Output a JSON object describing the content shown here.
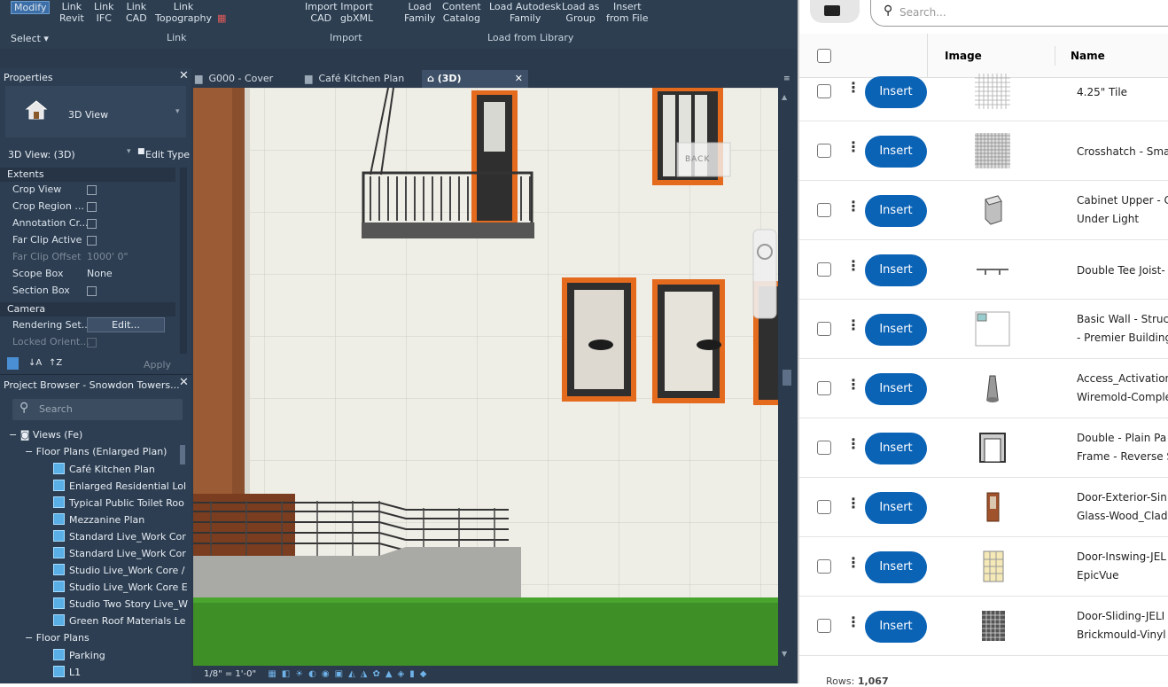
{
  "ribbon": {
    "modify": "Modify",
    "select": "Select ▾",
    "link_revit": "Link\nRevit",
    "link_ifc": "Link\nIFC",
    "link_cad": "Link\nCAD",
    "link_topo": "Link\nTopography",
    "link_group": "Link",
    "import_cad": "Import\nCAD",
    "import_gbxml": "Import\ngbXML",
    "import_group": "Import",
    "load_family": "Load\nFamily",
    "content_catalog": "Content\nCatalog",
    "load_autodesk": "Load Autodesk\nFamily",
    "load_group": "Load as\nGroup",
    "insert_file": "Insert\nfrom File",
    "load_library_group": "Load from Library"
  },
  "properties": {
    "title": "Properties",
    "type_name": "3D View",
    "view_selector": "3D View: (3D)",
    "edit_type": "Edit Type",
    "extents": "Extents",
    "rows": [
      {
        "label": "Crop View",
        "kind": "check"
      },
      {
        "label": "Crop Region ...",
        "kind": "check"
      },
      {
        "label": "Annotation Cr...",
        "kind": "check"
      },
      {
        "label": "Far Clip Active",
        "kind": "check"
      },
      {
        "label": "Far Clip Offset",
        "value": "1000'  0\"",
        "kind": "dim"
      },
      {
        "label": "Scope Box",
        "value": "None",
        "kind": "text"
      },
      {
        "label": "Section Box",
        "kind": "check"
      }
    ],
    "camera": "Camera",
    "rendering": "Rendering Set...",
    "edit_btn": "Edit...",
    "locked": "Locked Orient...",
    "apply": "Apply"
  },
  "browser": {
    "title": "Project Browser - Snowdon Towers...",
    "search_placeholder": "Search",
    "views": "Views (Fe)",
    "floor_plans_enlarged": "Floor Plans (Enlarged Plan)",
    "enlarged_items": [
      "Café Kitchen Plan",
      "Enlarged Residential Lol",
      "Typical Public Toilet Roo",
      "Mezzanine Plan",
      "Standard Live_Work Cor",
      "Standard Live_Work Cor",
      "Studio Live_Work Core /",
      "Studio Live_Work Core E",
      "Studio Two Story Live_W",
      "Green Roof Materials Le"
    ],
    "floor_plans": "Floor Plans",
    "plan_items": [
      "Parking",
      "L1"
    ]
  },
  "tabs": [
    {
      "label": "G000 - Cover"
    },
    {
      "label": "Café Kitchen Plan"
    },
    {
      "label": "(3D)"
    }
  ],
  "status": {
    "scale": "1/8\" = 1'-0\""
  },
  "viewcube": {
    "back": "BACK"
  },
  "library": {
    "search_placeholder": "Search...",
    "col_image": "Image",
    "col_name": "Name",
    "insert_label": "Insert",
    "rows": [
      {
        "line1": "4.25\" Tile",
        "line2": "",
        "thumb": "tile"
      },
      {
        "line1": "Crosshatch - Sma",
        "line2": "",
        "thumb": "crosshatch"
      },
      {
        "line1": "Cabinet Upper - C",
        "line2": "Under Light",
        "thumb": "cabinet"
      },
      {
        "line1": "Double Tee Joist-",
        "line2": "",
        "thumb": "joist"
      },
      {
        "line1": "Basic Wall - Struc",
        "line2": "- Premier Building",
        "thumb": "broken"
      },
      {
        "line1": "Access_Activation",
        "line2": "Wiremold-Comple",
        "thumb": "cone"
      },
      {
        "line1": "Double - Plain Pa",
        "line2": "Frame - Reverse S",
        "thumb": "doubledoor"
      },
      {
        "line1": "Door-Exterior-Sin",
        "line2": "Glass-Wood_Clad",
        "thumb": "door"
      },
      {
        "line1": "Door-Inswing-JEL",
        "line2": "EpicVue",
        "thumb": "window"
      },
      {
        "line1": "Door-Sliding-JELI",
        "line2": "Brickmould-Vinyl",
        "thumb": "grid"
      }
    ],
    "rows_label": "Rows:",
    "rows_count": "1,067"
  }
}
